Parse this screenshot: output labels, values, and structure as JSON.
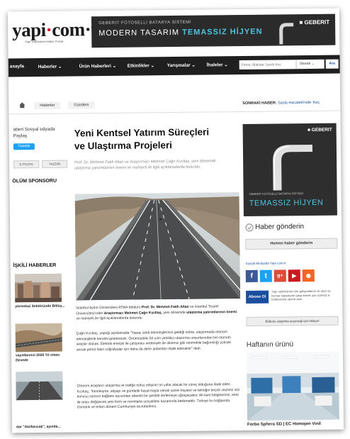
{
  "header": {
    "logo_text_left": "yapi",
    "logo_dot": "·",
    "logo_text_right": "com·tr",
    "logo_sub": "Yapı Sektörünün Haber Portalı",
    "ad": {
      "line1": "GEBERIT FOTOSELLİ BATARYA SİSTEMİ",
      "line2a": "MODERN TASARIM",
      "line2b": "TEMASSIZ HİJYEN",
      "brand": "■ GEBERIT"
    }
  },
  "nav": {
    "items": [
      "asayfa",
      "Haberler ⌄",
      "Ürün Haberleri ⌄",
      "Etkinlikler ⌄",
      "Yarışmalar ⌄",
      "İhaleler ⌄"
    ],
    "search_placeholder": "Firma, Makale, İçerik Ara",
    "select_value": "Ülkede ⌄",
    "go_label": "Ara"
  },
  "breadcrumb": {
    "items": [
      "Haberler",
      "Gündem"
    ],
    "next_label": "SONRAKİ HABER:",
    "next_title": "Sasla Hacabeli'nde 'Keç"
  },
  "left": {
    "share_text": "aberi Sosyal edyada Paylaş",
    "tweet_label": "Tweetle",
    "btn1": "E-POSTA",
    "btn2": "YAZDIR",
    "sponsor_heading": "ÖLÜM SPONSORU",
    "related_heading": "İŞKİLİ HABERLER",
    "related": [
      {
        "caption": "yörmekai Sektöründe Bölüş..."
      },
      {
        "caption": "vayollarının 2020 Yıl ıntası Devede"
      },
      {
        "caption": "dar \"Akıllasıcak\", ayında..."
      }
    ]
  },
  "article": {
    "title": "Yeni Kentsel Yatırım Süreçleri ve Ulaştırma Projeleri",
    "subtitle": "Prof. Dr. Mehmet Fatih Altan ve Araştırmacı Mehmet Çağrı Kızıltaş, yeni dönemde ulaştırma yatırımlarının önemi ve mahiyeti ile ilgili açıklamalarda bulundu.",
    "p1_a": "İstanbul Aydın Üniversitesi ATMA Müdürü",
    "p1_b": "Prof. Dr. Mehmet Fatih Altan",
    "p1_c": "ve İstanbul Ticaret Üniversitesi'nden",
    "p1_d": "Araştırmacı Mehmet Çağrı Kızıltaş,",
    "p1_e": "yeni dönemde",
    "p1_f": "ulaştırma yatırımlarının önemi",
    "p1_g": "ve mahiyeti ile ilgili açıklamalarda bulundu.",
    "p2": "Çağrı Kızıltaş, yaptığı açıklamada \"Yapay zekâ teknolojilerinin geldiği nokta, ulaştırmada otonom teknolojilerle kendini gösterecek. Önümüzdeki 50 yılın yenilikçi ulaştırma unsurlarından biri otonom araçlar olacak. Elektrik enerjisi ile çalışması nedeniyle de ülkemiz gibi otomobile bağımlılığı yüksek ancak petrol fakiri coğrafyalar için daha da derin anlamları ifade edecektir\" dedi.",
    "p3": "Otonom araçların ulaştırma ve trafiğe nüfuz edişinin on yıllar alacak bir süreç olduğuna ifade eden Kızıltaş, \"Kentleşme, altyapı ve gündelik hayat başta olmak üzere hayatın ve tekniğin birçok veçhesi söz konusu sürecin bağlamı açısından ahenkli bir şekilde ilerlemeye uğrayacaktır. Alt kent bölgelerinin, kent ile arası değişecek yeni form ve normlarla sosyalitesi kazanımla bekleneblir. Türkiye bu bağlamda Osmanlı ve erken dönem Cumhuriyet tecrübelerini,"
  },
  "right": {
    "ad": {
      "brand": "■ GEBERIT",
      "line1": "GEBERIT FOTOSELLİ BATARYA SİSTEMİ",
      "line2": "TEMASSIZ HİJYEN"
    },
    "send_heading": "Haber gönderin",
    "send_button": "Hemen haber gönderin",
    "social_heading": "Sosyal Medyada Yapı.com.tr",
    "social": [
      "f",
      "t",
      "g+",
      "▶",
      "◉"
    ],
    "subscribe_button": "Abone Ol",
    "subscribe_text": "Yapı sektörünün tüm gelişmelerini ve ürün ve hizmet haberlerini takip etmek için ücretsiz e-bültenimize abone olun.",
    "note_button": "Bültene ulaşılma seçeneği için tıklayın",
    "week_heading": "Haftanın ürünü",
    "week_caption": "Forbo Sphera SD | EC Homojen Vinil"
  },
  "colors": {
    "nav_bg": "#1f1f1f",
    "accent_blue": "#1a4fa0",
    "ad_teal": "#4ec3e0",
    "brand_red": "#c8102e"
  }
}
